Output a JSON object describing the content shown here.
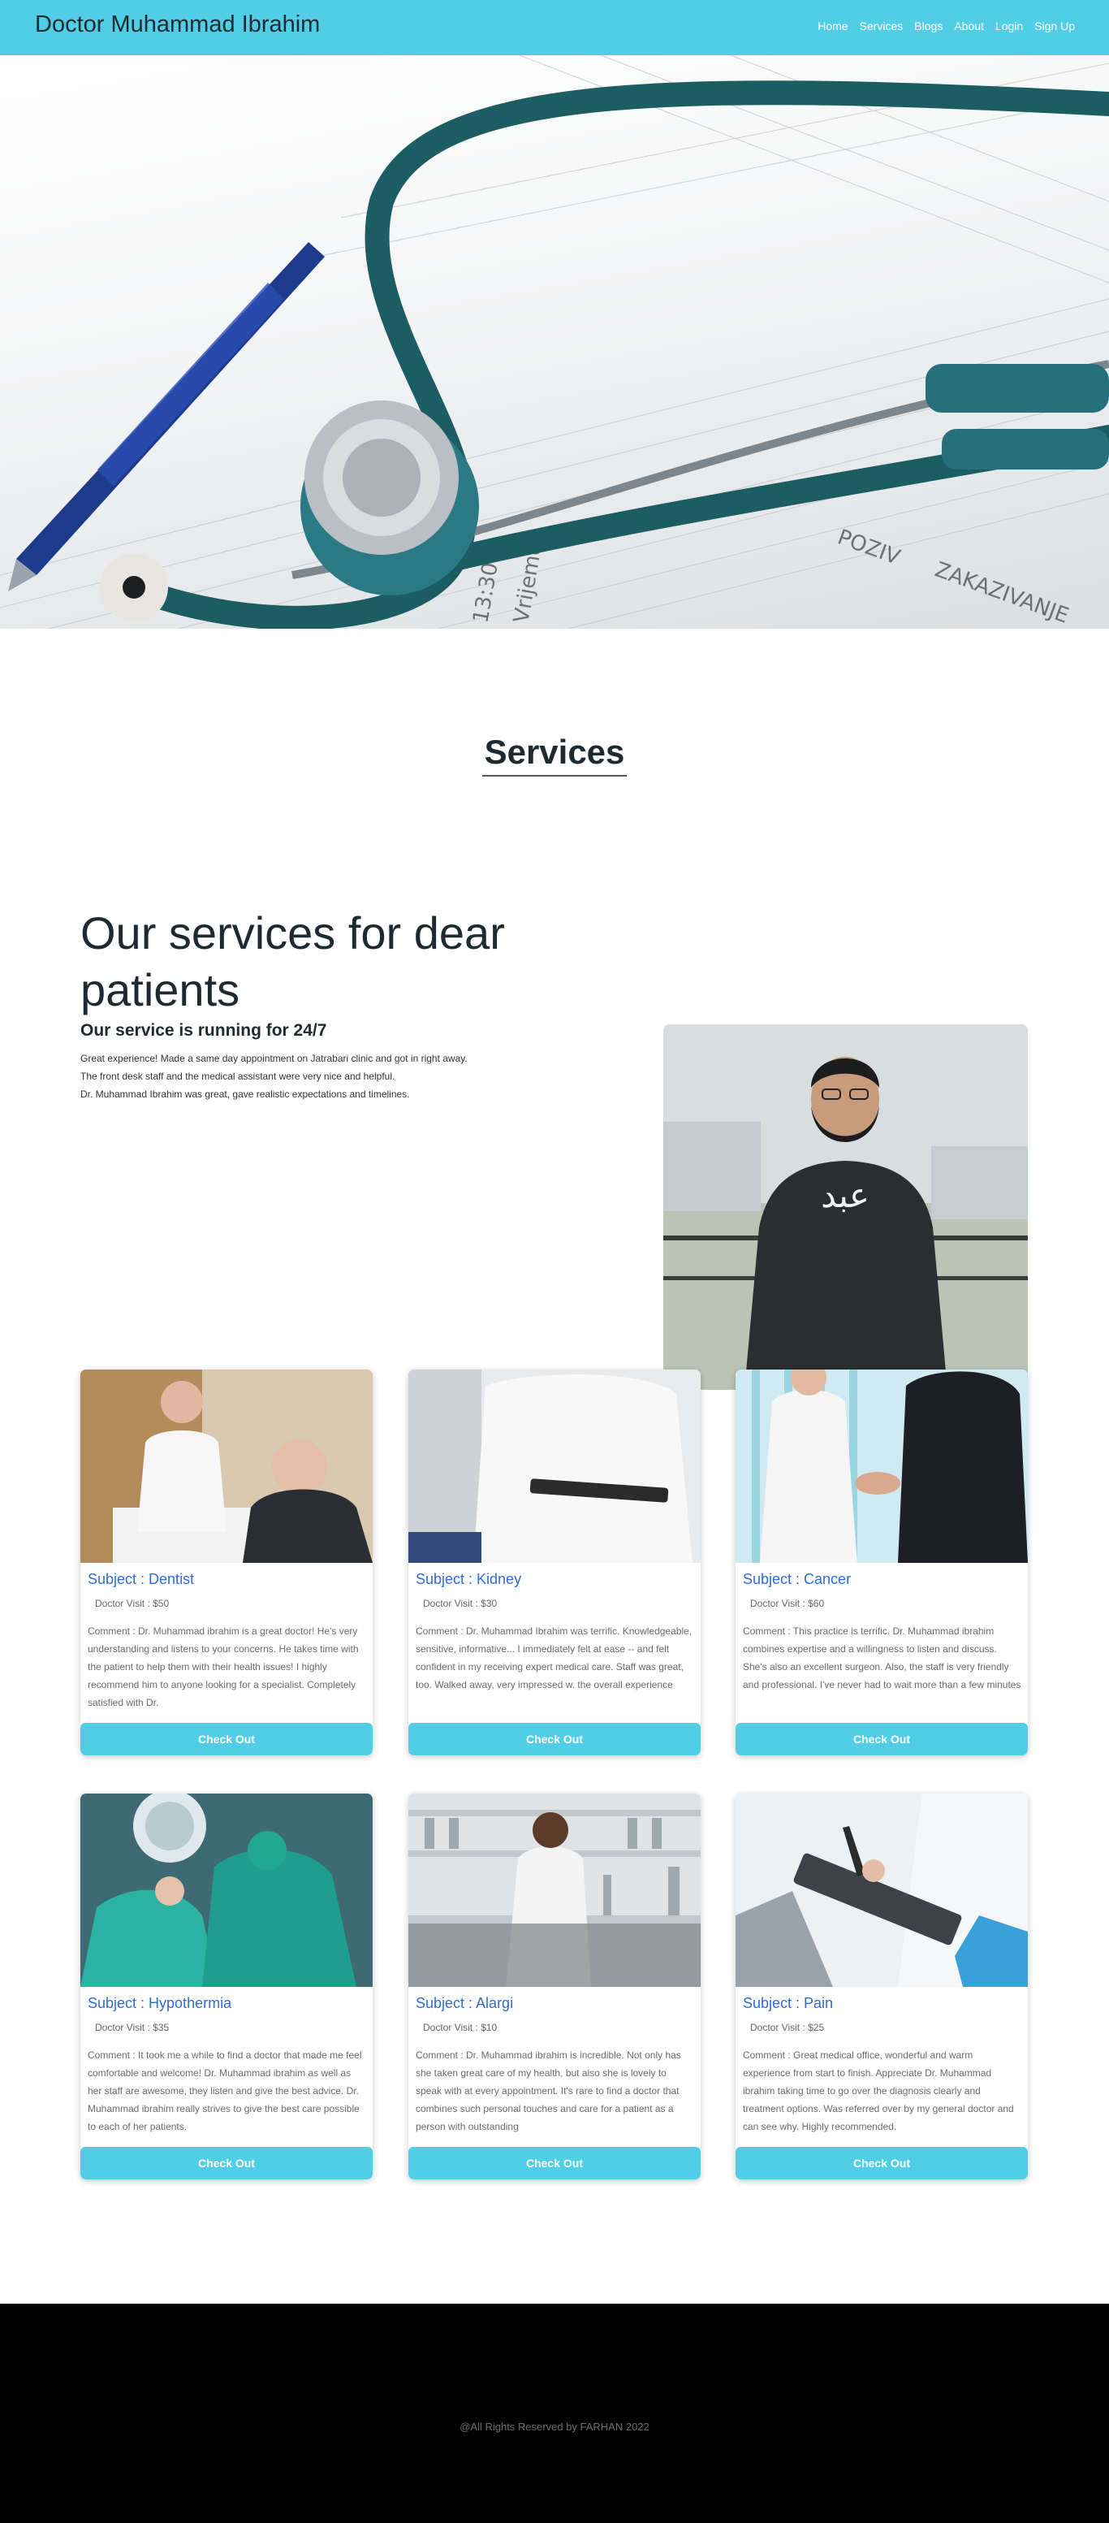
{
  "header": {
    "brand": "Doctor Muhammad Ibrahim",
    "nav": [
      "Home",
      "Services",
      "Blogs",
      "About",
      "Login",
      "Sign Up"
    ]
  },
  "hero": {
    "image": "stethoscope-and-pen-on-medical-form"
  },
  "services": {
    "title": "Services"
  },
  "intro": {
    "heading": "Our services for dear patients",
    "subheading": "Our service is running for 24/7",
    "lines": [
      "Great experience! Made a same day appointment on Jatrabari clinic and got in right away.",
      "The front desk staff and the medical assistant were very nice and helpful.",
      "Dr. Muhammad Ibrahim was great, gave realistic expectations and timelines."
    ],
    "portrait_badge": "عبد"
  },
  "cards": [
    {
      "subject": "Subject : Dentist",
      "price": "Doctor Visit : $50",
      "comment": "Comment : Dr. Muhammad ibrahim is a great doctor! He's very understanding and listens to your concerns. He takes time with the patient to help them with their health issues! I highly recommend him to anyone looking for a specialist. Completely satisfied with Dr.",
      "button": "Check Out",
      "image": "doctor-consultation"
    },
    {
      "subject": "Subject : Kidney",
      "price": "Doctor Visit : $30",
      "comment": "Comment : Dr. Muhammad Ibrahim was terrific. Knowledgeable, sensitive, informative... I immediately felt at ease -- and felt confident in my receiving expert medical care. Staff was great, too. Walked away, very impressed w. the overall experience",
      "button": "Check Out",
      "image": "doctor-with-tablet"
    },
    {
      "subject": "Subject : Cancer",
      "price": "Doctor Visit : $60",
      "comment": "Comment : This practice is terrific. Dr. Muhammad ibrahim combines expertise and a willingness to listen and discuss. She's also an excellent surgeon. Also, the staff is very friendly and professional. I've never had to wait more than a few minutes",
      "button": "Check Out",
      "image": "doctor-handshake"
    },
    {
      "subject": "Subject : Hypothermia",
      "price": "Doctor Visit : $35",
      "comment": "Comment : It took me a while to find a doctor that made me feel comfortable and welcome! Dr. Muhammad ibrahim as well as her staff are awesome, they listen and give the best advice. Dr. Muhammad ibrahim really strives to give the best care possible to each of her patients.",
      "button": "Check Out",
      "image": "surgery-team"
    },
    {
      "subject": "Subject : Alargi",
      "price": "Doctor Visit : $10",
      "comment": "Comment : Dr. Muhammad ibrahim is incredible. Not only has she taken great care of my health, but also she is lovely to speak with at every appointment. It's rare to find a doctor that combines such personal touches and care for a patient as a person with outstanding",
      "button": "Check Out",
      "image": "laboratory-researcher"
    },
    {
      "subject": "Subject : Pain",
      "price": "Doctor Visit : $25",
      "comment": "Comment : Great medical office, wonderful and warm experience from start to finish. Appreciate Dr. Muhammad ibrahim taking time to go over the diagnosis clearly and treatment options. Was referred over by my general doctor and can see why. Highly recommended.",
      "button": "Check Out",
      "image": "doctor-writing-on-clipboard"
    }
  ],
  "footer": {
    "text": "@All Rights Reserved by FARHAN 2022"
  },
  "colors": {
    "accent": "#52cde6",
    "subject": "#2f6cd8",
    "footer": "#000000"
  }
}
